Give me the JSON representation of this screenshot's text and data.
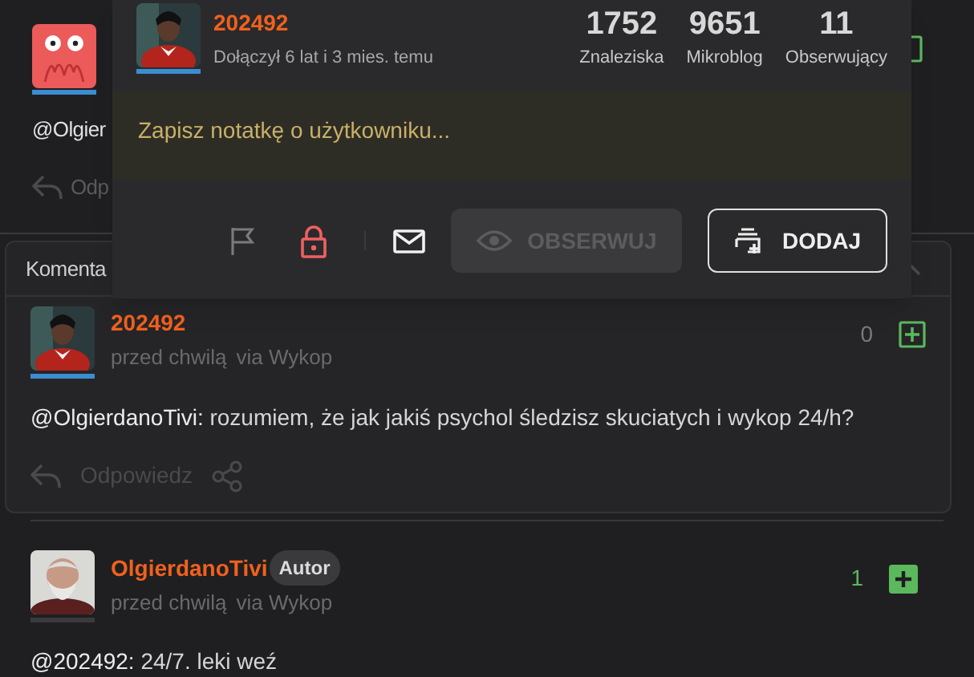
{
  "top_entry": {
    "text": "@Olgier",
    "reply_label": "Odp"
  },
  "comments_header": {
    "label": "Komenta",
    "expanded": true
  },
  "popup": {
    "username": "202492",
    "joined": "Dołączył 6 lat i 3 mies. temu",
    "stats": [
      {
        "value": "1752",
        "label": "Znaleziska"
      },
      {
        "value": "9651",
        "label": "Mikroblog"
      },
      {
        "value": "11",
        "label": "Obserwujący"
      }
    ],
    "note": {
      "placeholder": "Zapisz notatkę o użytkowniku..."
    },
    "follow_button": {
      "label": "OBSERWUJ",
      "disabled": true
    },
    "add_button": {
      "label": "DODAJ"
    }
  },
  "comments": [
    {
      "author": "202492",
      "time": "przed chwilą",
      "source": "via Wykop",
      "votes": "0",
      "voted": false,
      "mention": "@OlgierdanoTivi:",
      "text": " rozumiem, że jak jakiś psychol śledzisz skuciatych i wykop 24/h?",
      "reply_label": "Odpowiedz"
    },
    {
      "author": "OlgierdanoTivi",
      "badge": "Autor",
      "time": "przed chwilą",
      "source": "via Wykop",
      "votes": "1",
      "voted": true,
      "mention": "@202492:",
      "text": " 24/7. leki weź"
    }
  ]
}
